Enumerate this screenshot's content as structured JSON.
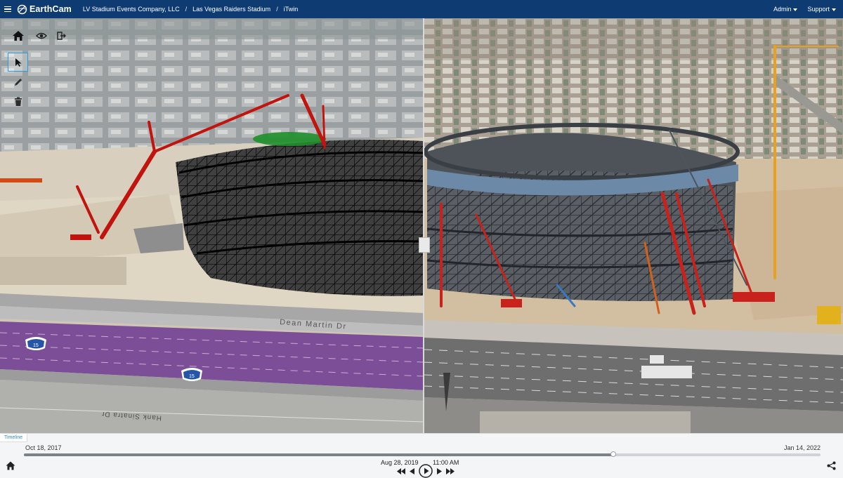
{
  "topbar": {
    "logo_text": "EarthCam",
    "breadcrumbs": [
      "LV Stadium Events Company, LLC",
      "Las Vegas Raiders Stadium",
      "iTwin"
    ],
    "separator": "/",
    "admin_label": "Admin",
    "support_label": "Support",
    "bg_color": "#0f3b73"
  },
  "viewport": {
    "left_labels": {
      "street_1": "Dean Martin Dr",
      "street_2": "Hank Sinatra Dr",
      "shield_1": "15",
      "shield_2": "15"
    },
    "tools": [
      "home-icon",
      "eye-icon",
      "exit-icon",
      "cursor-icon",
      "pencil-icon",
      "trash-icon"
    ]
  },
  "timeline": {
    "tab_label": "Timeline",
    "start_date": "Oct 18, 2017",
    "end_date": "Jan 14, 2022",
    "current_date": "Aug 28, 2019",
    "current_time": "11:00 AM",
    "progress": 0.74,
    "accent_color": "#2a8ad0"
  }
}
